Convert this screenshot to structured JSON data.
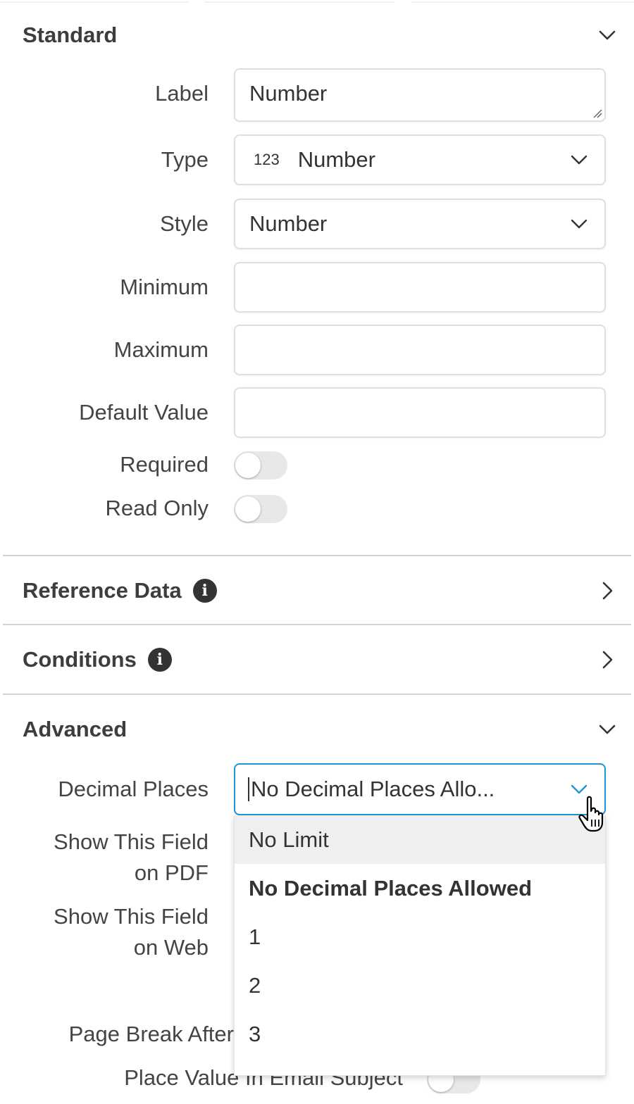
{
  "sections": {
    "standard": {
      "title": "Standard"
    },
    "reference_data": {
      "title": "Reference Data"
    },
    "conditions": {
      "title": "Conditions"
    },
    "advanced": {
      "title": "Advanced"
    }
  },
  "standard_fields": {
    "label": {
      "label": "Label",
      "value": "Number"
    },
    "type": {
      "label": "Type",
      "icon_text": "123",
      "value": "Number"
    },
    "style": {
      "label": "Style",
      "value": "Number"
    },
    "minimum": {
      "label": "Minimum",
      "value": ""
    },
    "maximum": {
      "label": "Maximum",
      "value": ""
    },
    "default_value": {
      "label": "Default Value",
      "value": ""
    },
    "required": {
      "label": "Required",
      "on": false
    },
    "read_only": {
      "label": "Read Only",
      "on": false
    }
  },
  "advanced_fields": {
    "decimal_places": {
      "label": "Decimal Places",
      "value": "No Decimal Places Allo..."
    },
    "show_on_pdf": {
      "label_line1": "Show This Field",
      "label_line2": "on PDF"
    },
    "show_on_web": {
      "label_line1": "Show This Field",
      "label_line2": "on Web"
    },
    "page_break_after": {
      "label": "Page Break After"
    },
    "place_value_in_email_subject": {
      "label": "Place Value In Email Subject",
      "on": false
    }
  },
  "decimal_dropdown": {
    "options": [
      "No Limit",
      "No Decimal Places Allowed",
      "1",
      "2",
      "3"
    ],
    "hovered": "No Limit",
    "selected": "No Decimal Places Allowed"
  },
  "colors": {
    "focus_border": "#2196d3",
    "divider": "#c9d5e0",
    "toggle_off": "#e8e8e8",
    "hover_bg": "#efefef"
  },
  "icons": {
    "section_expanded": "chevron-down-icon",
    "section_collapsed": "chevron-right-icon",
    "info": "info-icon",
    "cursor": "hand-pointer-icon"
  }
}
